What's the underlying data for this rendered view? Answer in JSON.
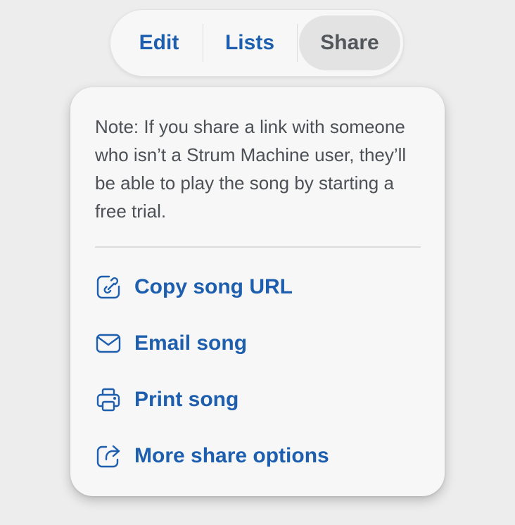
{
  "tabs": {
    "edit": "Edit",
    "lists": "Lists",
    "share": "Share",
    "active": "share"
  },
  "share_panel": {
    "note": "Note: If you share a link with someone who isn’t a Strum Machine user, they’ll be able to play the song by starting a free trial.",
    "items": [
      {
        "icon": "copy-link-icon",
        "label": "Copy song URL"
      },
      {
        "icon": "envelope-icon",
        "label": "Email song"
      },
      {
        "icon": "printer-icon",
        "label": "Print song"
      },
      {
        "icon": "share-arrow-icon",
        "label": "More share options"
      }
    ]
  },
  "colors": {
    "accent": "#1d5fae",
    "active_tab_text": "#53565a",
    "active_tab_bg": "#e3e3e3",
    "note_text": "#4d5156",
    "panel_bg": "#f7f7f7",
    "page_bg": "#ededed"
  }
}
